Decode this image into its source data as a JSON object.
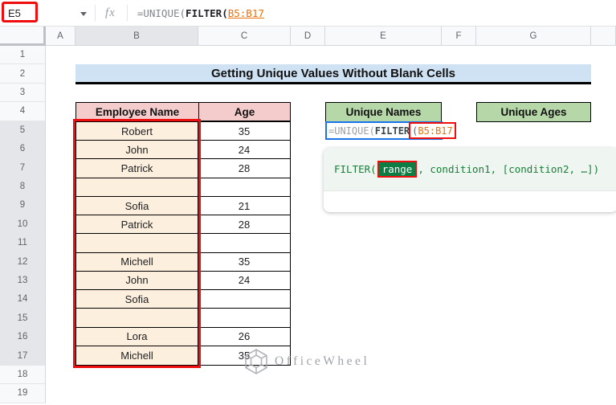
{
  "toolbar": {
    "name_box": "E5",
    "fx_icon": "fx",
    "formula": {
      "prefix": "=UNIQUE(",
      "function": "FILTER(",
      "range": "B5:B17"
    }
  },
  "grid": {
    "column_labels": [
      "A",
      "B",
      "C",
      "D",
      "E",
      "F",
      "G",
      ""
    ],
    "row_numbers": [
      1,
      2,
      3,
      4,
      5,
      6,
      7,
      8,
      9,
      10,
      11,
      12,
      13,
      14,
      15,
      16,
      17,
      18,
      19
    ],
    "highlighted_column": "B",
    "highlighted_row_start": 5,
    "highlighted_row_end": 17
  },
  "content": {
    "title": "Getting Unique Values Without Blank Cells",
    "employee_table": {
      "name_header": "Employee Name",
      "age_header": "Age",
      "rows": [
        {
          "name": "Robert",
          "age": "35"
        },
        {
          "name": "John",
          "age": "24"
        },
        {
          "name": "Patrick",
          "age": "28"
        },
        {
          "name": "",
          "age": ""
        },
        {
          "name": "Sofia",
          "age": "21"
        },
        {
          "name": "Patrick",
          "age": "28"
        },
        {
          "name": "",
          "age": ""
        },
        {
          "name": "Michell",
          "age": "35"
        },
        {
          "name": "John",
          "age": "24"
        },
        {
          "name": "Sofia",
          "age": ""
        },
        {
          "name": "",
          "age": ""
        },
        {
          "name": "Lora",
          "age": "26"
        },
        {
          "name": "Michell",
          "age": "35"
        }
      ]
    },
    "unique_names_header": "Unique Names",
    "unique_ages_header": "Unique Ages",
    "cell_formula": {
      "prefix": "=UNIQUE(",
      "function": "FILTER",
      "paren": "(",
      "range": "B5:B17"
    },
    "formula_tooltip": {
      "before": "FILTER(",
      "highlighted_arg": "range",
      "after": ", condition1, [condition2, …])"
    }
  },
  "watermark": {
    "text": "OfficeWheel"
  },
  "colors": {
    "title_bg": "#cfe2f3",
    "table_header_bg": "#f4cccc",
    "name_cell_bg": "#fcefdd",
    "unique_header_bg": "#b6d7a8",
    "annotation_red": "#ee0e0e",
    "range_orange": "#e8710a",
    "edit_border_blue": "#1a73e8",
    "tooltip_green": "#188038",
    "chip_green_bg": "#0d7d43"
  }
}
